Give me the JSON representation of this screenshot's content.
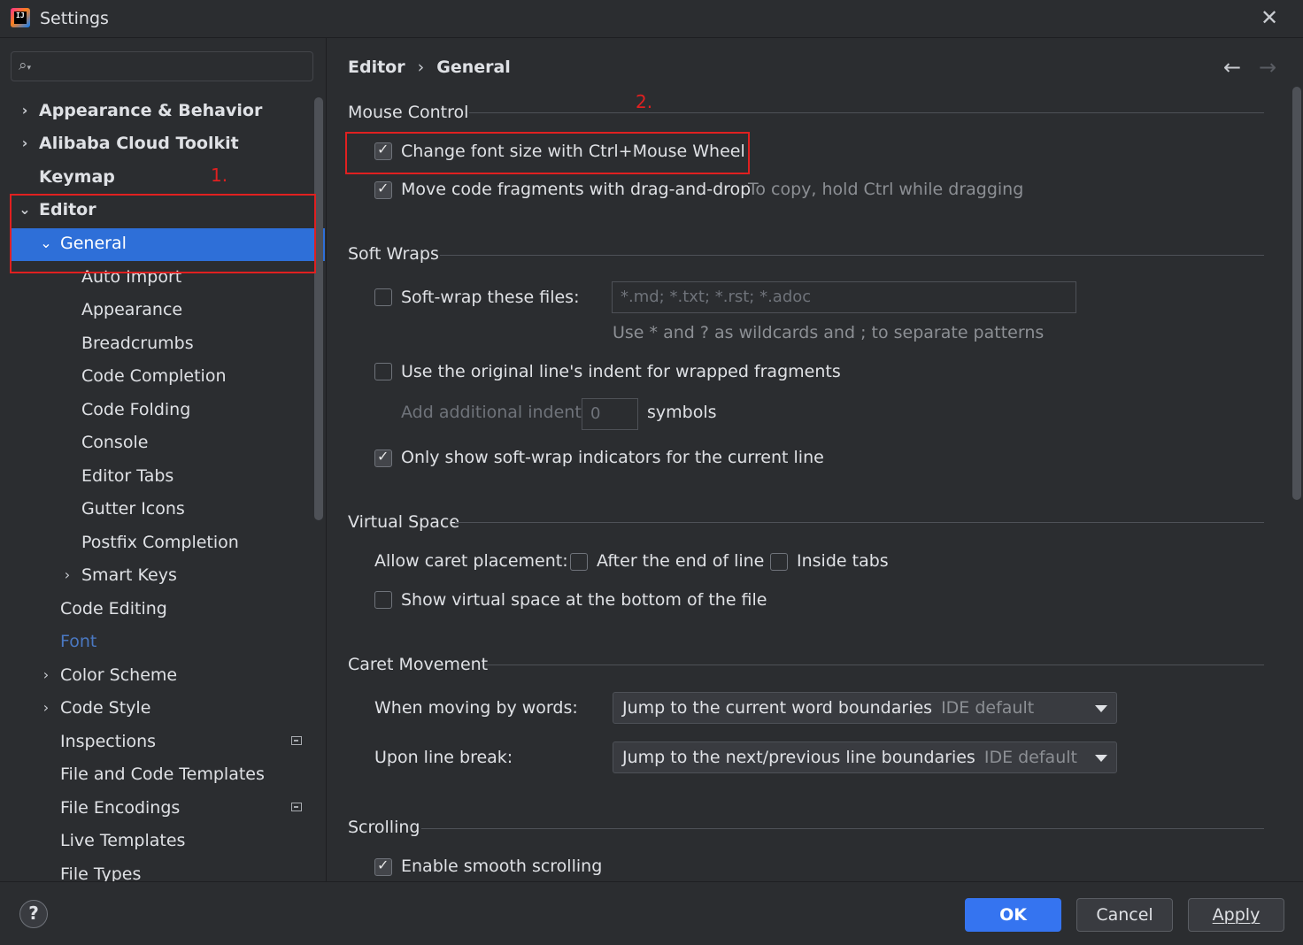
{
  "window": {
    "title": "Settings"
  },
  "search": {
    "placeholder": ""
  },
  "sidebar": {
    "items": [
      {
        "label": "Appearance & Behavior"
      },
      {
        "label": "Alibaba Cloud Toolkit"
      },
      {
        "label": "Keymap"
      },
      {
        "label": "Editor"
      },
      {
        "label": "General"
      },
      {
        "label": "Auto Import"
      },
      {
        "label": "Appearance"
      },
      {
        "label": "Breadcrumbs"
      },
      {
        "label": "Code Completion"
      },
      {
        "label": "Code Folding"
      },
      {
        "label": "Console"
      },
      {
        "label": "Editor Tabs"
      },
      {
        "label": "Gutter Icons"
      },
      {
        "label": "Postfix Completion"
      },
      {
        "label": "Smart Keys"
      },
      {
        "label": "Code Editing"
      },
      {
        "label": "Font"
      },
      {
        "label": "Color Scheme"
      },
      {
        "label": "Code Style"
      },
      {
        "label": "Inspections"
      },
      {
        "label": "File and Code Templates"
      },
      {
        "label": "File Encodings"
      },
      {
        "label": "Live Templates"
      },
      {
        "label": "File Types"
      }
    ]
  },
  "breadcrumb": {
    "parent": "Editor",
    "current": "General",
    "separator": "›"
  },
  "annotations": {
    "one": "1.",
    "two": "2."
  },
  "mouse_control": {
    "title": "Mouse Control",
    "change_font": {
      "label": "Change font size with Ctrl+Mouse Wheel",
      "checked": true
    },
    "move_code": {
      "label": "Move code fragments with drag-and-drop",
      "checked": true,
      "hint": "To copy, hold Ctrl while dragging"
    }
  },
  "soft_wraps": {
    "title": "Soft Wraps",
    "soft_wrap_files": {
      "label": "Soft-wrap these files:",
      "checked": false,
      "value": "*.md; *.txt; *.rst; *.adoc",
      "hint": "Use * and ? as wildcards and ; to separate patterns"
    },
    "original_indent": {
      "label": "Use the original line's indent for wrapped fragments",
      "checked": false
    },
    "additional_indent": {
      "label": "Add additional indent:",
      "value": "0",
      "suffix": "symbols"
    },
    "only_current_line": {
      "label": "Only show soft-wrap indicators for the current line",
      "checked": true
    }
  },
  "virtual_space": {
    "title": "Virtual Space",
    "caret_label": "Allow caret placement:",
    "after_end": {
      "label": "After the end of line",
      "checked": false
    },
    "inside_tabs": {
      "label": "Inside tabs",
      "checked": false
    },
    "show_bottom": {
      "label": "Show virtual space at the bottom of the file",
      "checked": false
    }
  },
  "caret_movement": {
    "title": "Caret Movement",
    "words_label": "When moving by words:",
    "words_value": "Jump to the current word boundaries",
    "words_hint": "IDE default",
    "break_label": "Upon line break:",
    "break_value": "Jump to the next/previous line boundaries",
    "break_hint": "IDE default"
  },
  "scrolling": {
    "title": "Scrolling",
    "smooth": {
      "label": "Enable smooth scrolling",
      "checked": true
    }
  },
  "footer": {
    "help": "?",
    "ok": "OK",
    "cancel": "Cancel",
    "apply": "Apply"
  },
  "colors": {
    "accent": "#3574f0",
    "selection": "#2e6fd8",
    "annotation": "#e02020",
    "background": "#2b2d30"
  }
}
